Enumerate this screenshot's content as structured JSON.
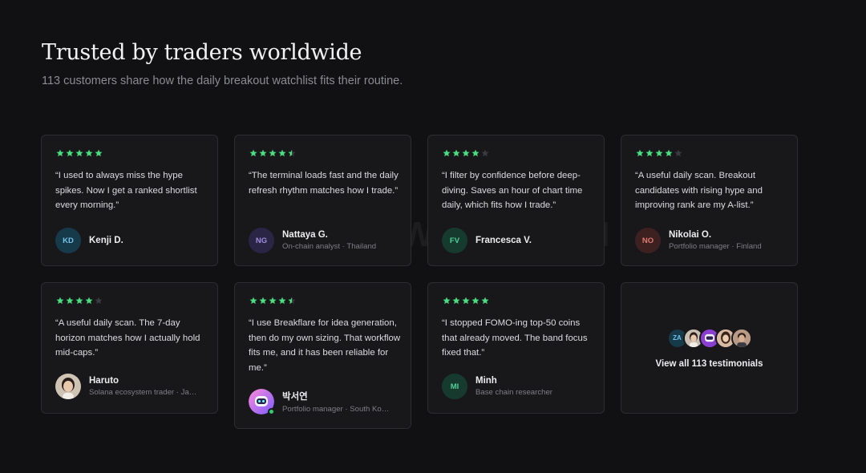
{
  "header": {
    "title": "Trusted by traders worldwide",
    "subtitle": "113 customers share how the daily breakout watchlist fits their routine."
  },
  "colors": {
    "star_on": "#4ade80",
    "star_off": "#3a3a40"
  },
  "watermark": "CRYPTWEEK.COM",
  "testimonials": [
    {
      "rating": 5,
      "quote": "“I used to always miss the hype spikes. Now I get a ranked shortlist every morning.”",
      "initials": "KD",
      "name": "Kenji D.",
      "role": "",
      "avatar_bg": "#173a4a",
      "avatar_fg": "#6fc3e8"
    },
    {
      "rating": 4.5,
      "quote": "“The terminal loads fast and the daily refresh rhythm matches how I trade.”",
      "initials": "NG",
      "name": "Nattaya G.",
      "role": "On-chain analyst · Thailand",
      "avatar_bg": "#2a2545",
      "avatar_fg": "#9d8ee0"
    },
    {
      "rating": 4,
      "quote": "“I filter by confidence before deep-diving. Saves an hour of chart time daily, which fits how I trade.”",
      "initials": "FV",
      "name": "Francesca V.",
      "role": "",
      "avatar_bg": "#163a2e",
      "avatar_fg": "#4fd29a"
    },
    {
      "rating": 4,
      "quote": "“A useful daily scan. Breakout candidates with rising hype and improving rank are my A-list.”",
      "initials": "NO",
      "name": "Nikolai O.",
      "role": "Portfolio manager · Finland",
      "avatar_bg": "#3d2020",
      "avatar_fg": "#e07b6e"
    },
    {
      "rating": 4,
      "quote": "“A useful daily scan. The 7-day horizon matches how I actually hold mid-caps.”",
      "initials": "",
      "name": "Haruto",
      "role": "Solana ecosystem trader · Ja…",
      "avatar_bg": "#cfc3b4",
      "avatar_fg": "#3b2a20"
    },
    {
      "rating": 4.5,
      "quote": "“I use Breakflare for idea generation, then do my own sizing. That workflow fits me, and it has been reliable for me.”",
      "initials": "",
      "name": "박서연",
      "role": "Portfolio manager · South Ko…",
      "avatar_bg": "#e26fcf",
      "avatar_fg": "#ffffff"
    },
    {
      "rating": 5,
      "quote": "“I stopped FOMO-ing top-50 coins that already moved. The band focus fixed that.”",
      "initials": "MI",
      "name": "Minh",
      "role": "Base chain researcher",
      "avatar_bg": "#163a2e",
      "avatar_fg": "#4fd29a"
    }
  ],
  "view_all": {
    "label": "View all 113 testimonials",
    "avatars": [
      {
        "initials": "ZA",
        "bg": "#173a4a",
        "fg": "#6fc3e8"
      },
      {
        "initials": "",
        "bg": "#c9bfb2",
        "fg": "#333"
      },
      {
        "initials": "",
        "bg": "#8a3fd1",
        "fg": "#fff"
      },
      {
        "initials": "",
        "bg": "#d9b9a2",
        "fg": "#333"
      },
      {
        "initials": "",
        "bg": "#b89a86",
        "fg": "#333"
      }
    ]
  }
}
